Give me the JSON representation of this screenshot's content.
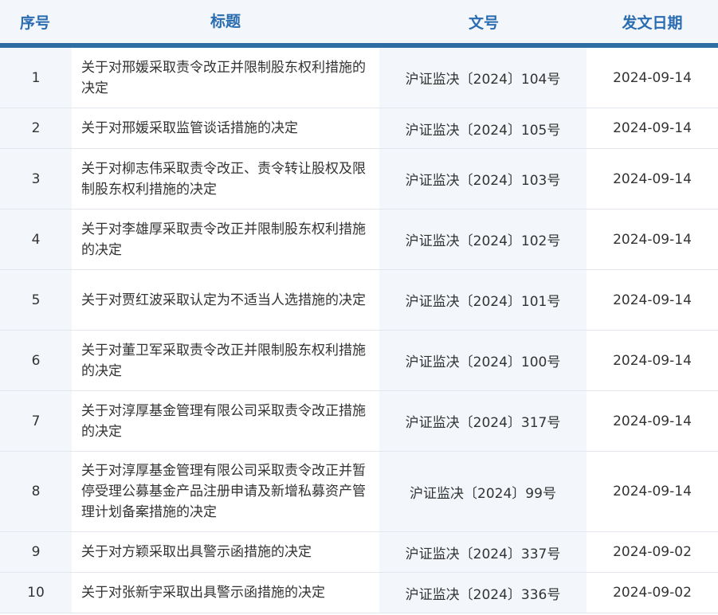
{
  "headers": {
    "no": "序号",
    "title": "标题",
    "doc": "文号",
    "date": "发文日期"
  },
  "rows": [
    {
      "no": "1",
      "title": "关于对邢媛采取责令改正并限制股东权利措施的决定",
      "doc": "沪证监决〔2024〕104号",
      "date": "2024-09-14"
    },
    {
      "no": "2",
      "title": "关于对邢媛采取监管谈话措施的决定",
      "doc": "沪证监决〔2024〕105号",
      "date": "2024-09-14"
    },
    {
      "no": "3",
      "title": "关于对柳志伟采取责令改正、责令转让股权及限制股东权利措施的决定",
      "doc": "沪证监决〔2024〕103号",
      "date": "2024-09-14"
    },
    {
      "no": "4",
      "title": "关于对李雄厚采取责令改正并限制股东权利措施的决定",
      "doc": "沪证监决〔2024〕102号",
      "date": "2024-09-14"
    },
    {
      "no": "5",
      "title": "关于对贾红波采取认定为不适当人选措施的决定",
      "doc": "沪证监决〔2024〕101号",
      "date": "2024-09-14"
    },
    {
      "no": "6",
      "title": "关于对董卫军采取责令改正并限制股东权利措施的决定",
      "doc": "沪证监决〔2024〕100号",
      "date": "2024-09-14"
    },
    {
      "no": "7",
      "title": "关于对淳厚基金管理有限公司采取责令改正措施的决定",
      "doc": "沪证监决〔2024〕317号",
      "date": "2024-09-14"
    },
    {
      "no": "8",
      "title": "关于对淳厚基金管理有限公司采取责令改正并暂停受理公募基金产品注册申请及新增私募资产管理计划备案措施的决定",
      "doc": "沪证监决〔2024〕99号",
      "date": "2024-09-14"
    },
    {
      "no": "9",
      "title": "关于对方颖采取出具警示函措施的决定",
      "doc": "沪证监决〔2024〕337号",
      "date": "2024-09-02"
    },
    {
      "no": "10",
      "title": "关于对张新宇采取出具警示函措施的决定",
      "doc": "沪证监决〔2024〕336号",
      "date": "2024-09-02"
    }
  ]
}
